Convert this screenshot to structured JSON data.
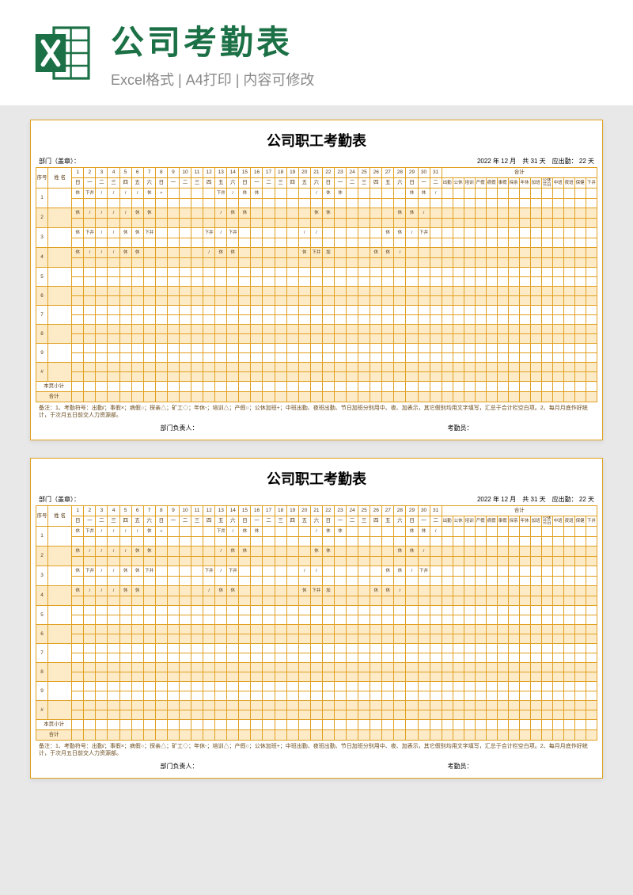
{
  "header": {
    "title": "公司考勤表",
    "subtitle": "Excel格式 | A4打印 | 内容可修改"
  },
  "sheet": {
    "title": "公司职工考勤表",
    "dept_label": "部门（盖章）：",
    "year": "2022",
    "year_label": "年",
    "month": "12",
    "month_label": "月",
    "total_label": "共",
    "total_days": "31",
    "days_unit": "天",
    "should_attend_label": "应出勤：",
    "should_attend": "22",
    "seq_label": "序号",
    "name_label": "姓 名",
    "day_nums": [
      "1",
      "2",
      "3",
      "4",
      "5",
      "6",
      "7",
      "8",
      "9",
      "10",
      "11",
      "12",
      "13",
      "14",
      "15",
      "16",
      "17",
      "18",
      "19",
      "20",
      "21",
      "22",
      "23",
      "24",
      "25",
      "26",
      "27",
      "28",
      "29",
      "30",
      "31"
    ],
    "weekdays": [
      "日",
      "一",
      "二",
      "三",
      "四",
      "五",
      "六",
      "日",
      "一",
      "二",
      "三",
      "四",
      "五",
      "六",
      "日",
      "一",
      "二",
      "三",
      "四",
      "五",
      "六",
      "日",
      "一",
      "二",
      "三",
      "四",
      "五",
      "六",
      "日",
      "一",
      "二"
    ],
    "summary_top": "合计",
    "summary_cols": [
      "出勤",
      "公休",
      "培训",
      "产假",
      "病假",
      "事假",
      "探亲",
      "年休",
      "加班",
      "公休节日",
      "中班",
      "夜班",
      "保健",
      "下井"
    ],
    "rows": [
      {
        "seq": "1",
        "cells": [
          "休",
          "下井",
          "/",
          "/",
          "/",
          "/",
          "休",
          "+",
          "",
          "",
          "",
          "",
          "下井",
          "/",
          "休",
          "休",
          "",
          "",
          "",
          "",
          "/",
          "休",
          "休",
          "",
          "",
          "",
          "",
          "",
          "休",
          "休",
          "/"
        ]
      },
      {
        "seq": "2",
        "cells": [
          "休",
          "/",
          "/",
          "/",
          "/",
          "休",
          "休",
          "",
          "",
          "",
          "",
          "",
          "/",
          "休",
          "休",
          "",
          "",
          "",
          "",
          "",
          "休",
          "休",
          "",
          "",
          "",
          "",
          "",
          "休",
          "休",
          "/",
          ""
        ]
      },
      {
        "seq": "3",
        "cells": [
          "休",
          "下井",
          "/",
          "/",
          "休",
          "休",
          "下井",
          "",
          "",
          "",
          "",
          "下井",
          "/",
          "下井",
          "",
          "",
          "",
          "",
          "",
          "/",
          "/",
          "",
          "",
          "",
          "",
          "",
          "休",
          "休",
          "/",
          "下井",
          ""
        ]
      },
      {
        "seq": "4",
        "cells": [
          "休",
          "/",
          "/",
          "/",
          "休",
          "休",
          "",
          "",
          "",
          "",
          "",
          "/",
          "休",
          "休",
          "",
          "",
          "",
          "",
          "",
          "休",
          "下井",
          "加",
          "",
          "",
          "",
          "休",
          "休",
          "/",
          "",
          "",
          ""
        ]
      },
      {
        "seq": "5",
        "cells": [
          "",
          "",
          "",
          "",
          "",
          "",
          "",
          "",
          "",
          "",
          "",
          "",
          "",
          "",
          "",
          "",
          "",
          "",
          "",
          "",
          "",
          "",
          "",
          "",
          "",
          "",
          "",
          "",
          "",
          "",
          ""
        ]
      },
      {
        "seq": "6",
        "cells": [
          "",
          "",
          "",
          "",
          "",
          "",
          "",
          "",
          "",
          "",
          "",
          "",
          "",
          "",
          "",
          "",
          "",
          "",
          "",
          "",
          "",
          "",
          "",
          "",
          "",
          "",
          "",
          "",
          "",
          "",
          ""
        ]
      },
      {
        "seq": "7",
        "cells": [
          "",
          "",
          "",
          "",
          "",
          "",
          "",
          "",
          "",
          "",
          "",
          "",
          "",
          "",
          "",
          "",
          "",
          "",
          "",
          "",
          "",
          "",
          "",
          "",
          "",
          "",
          "",
          "",
          "",
          "",
          ""
        ]
      },
      {
        "seq": "8",
        "cells": [
          "",
          "",
          "",
          "",
          "",
          "",
          "",
          "",
          "",
          "",
          "",
          "",
          "",
          "",
          "",
          "",
          "",
          "",
          "",
          "",
          "",
          "",
          "",
          "",
          "",
          "",
          "",
          "",
          "",
          "",
          ""
        ]
      },
      {
        "seq": "9",
        "cells": [
          "",
          "",
          "",
          "",
          "",
          "",
          "",
          "",
          "",
          "",
          "",
          "",
          "",
          "",
          "",
          "",
          "",
          "",
          "",
          "",
          "",
          "",
          "",
          "",
          "",
          "",
          "",
          "",
          "",
          "",
          ""
        ]
      },
      {
        "seq": "#",
        "cells": [
          "",
          "",
          "",
          "",
          "",
          "",
          "",
          "",
          "",
          "",
          "",
          "",
          "",
          "",
          "",
          "",
          "",
          "",
          "",
          "",
          "",
          "",
          "",
          "",
          "",
          "",
          "",
          "",
          "",
          "",
          ""
        ]
      }
    ],
    "page_subtotal": "本页小计",
    "total": "合计",
    "note": "备注：1、考勤符号：出勤/；事假×；病假○；探亲△；矿工◇；年休-；培训△；产假○；公休加班+；中班出勤、夜班出勤、节日加班分别用中、夜、加表示，其它假别均用文字填写，汇总于合计栏空白项。2、每月月底作好统计，于次月五日前交人力资源部。",
    "dept_mgr": "部门负责人：",
    "clerk": "考勤员："
  },
  "chart_data": {
    "type": "table",
    "title": "公司职工考勤表",
    "year": 2022,
    "month": 12,
    "days_in_month": 31,
    "expected_attendance_days": 22,
    "day_columns": [
      1,
      2,
      3,
      4,
      5,
      6,
      7,
      8,
      9,
      10,
      11,
      12,
      13,
      14,
      15,
      16,
      17,
      18,
      19,
      20,
      21,
      22,
      23,
      24,
      25,
      26,
      27,
      28,
      29,
      30,
      31
    ],
    "weekday_labels": [
      "日",
      "一",
      "二",
      "三",
      "四",
      "五",
      "六",
      "日",
      "一",
      "二",
      "三",
      "四",
      "五",
      "六",
      "日",
      "一",
      "二",
      "三",
      "四",
      "五",
      "六",
      "日",
      "一",
      "二",
      "三",
      "四",
      "五",
      "六",
      "日",
      "一",
      "二"
    ],
    "summary_columns": [
      "出勤",
      "公休",
      "培训",
      "产假",
      "病假",
      "事假",
      "探亲",
      "年休",
      "加班",
      "公休节日",
      "中班",
      "夜班",
      "保健",
      "下井"
    ],
    "legend": {
      "/": "出勤",
      "×": "事假",
      "○": "病假/产假",
      "△": "探亲/培训",
      "◇": "矿工",
      "-": "年休",
      "+": "公休加班",
      "中": "中班出勤",
      "夜": "夜班出勤",
      "加": "节日加班",
      "休": "公休",
      "下井": "下井"
    },
    "employees": [
      {
        "row": 1,
        "marks": [
          "休",
          "下井",
          "/",
          "/",
          "/",
          "/",
          "休",
          "+",
          "",
          "",
          "",
          "",
          "下井",
          "/",
          "休",
          "休",
          "",
          "",
          "",
          "",
          "/",
          "休",
          "休",
          "",
          "",
          "",
          "",
          "",
          "休",
          "休",
          "/"
        ]
      },
      {
        "row": 2,
        "marks": [
          "休",
          "/",
          "/",
          "/",
          "/",
          "休",
          "休",
          "",
          "",
          "",
          "",
          "",
          "/",
          "休",
          "休",
          "",
          "",
          "",
          "",
          "",
          "休",
          "休",
          "",
          "",
          "",
          "",
          "",
          "休",
          "休",
          "/",
          ""
        ]
      },
      {
        "row": 3,
        "marks": [
          "休",
          "下井",
          "/",
          "/",
          "休",
          "休",
          "下井",
          "",
          "",
          "",
          "",
          "下井",
          "/",
          "下井",
          "",
          "",
          "",
          "",
          "",
          "/",
          "/",
          "",
          "",
          "",
          "",
          "",
          "休",
          "休",
          "/",
          "下井",
          ""
        ]
      },
      {
        "row": 4,
        "marks": [
          "休",
          "/",
          "/",
          "/",
          "休",
          "休",
          "",
          "",
          "",
          "",
          "",
          "/",
          "休",
          "休",
          "",
          "",
          "",
          "",
          "",
          "休",
          "下井",
          "加",
          "",
          "",
          "",
          "休",
          "休",
          "/",
          "",
          "",
          ""
        ]
      }
    ]
  }
}
